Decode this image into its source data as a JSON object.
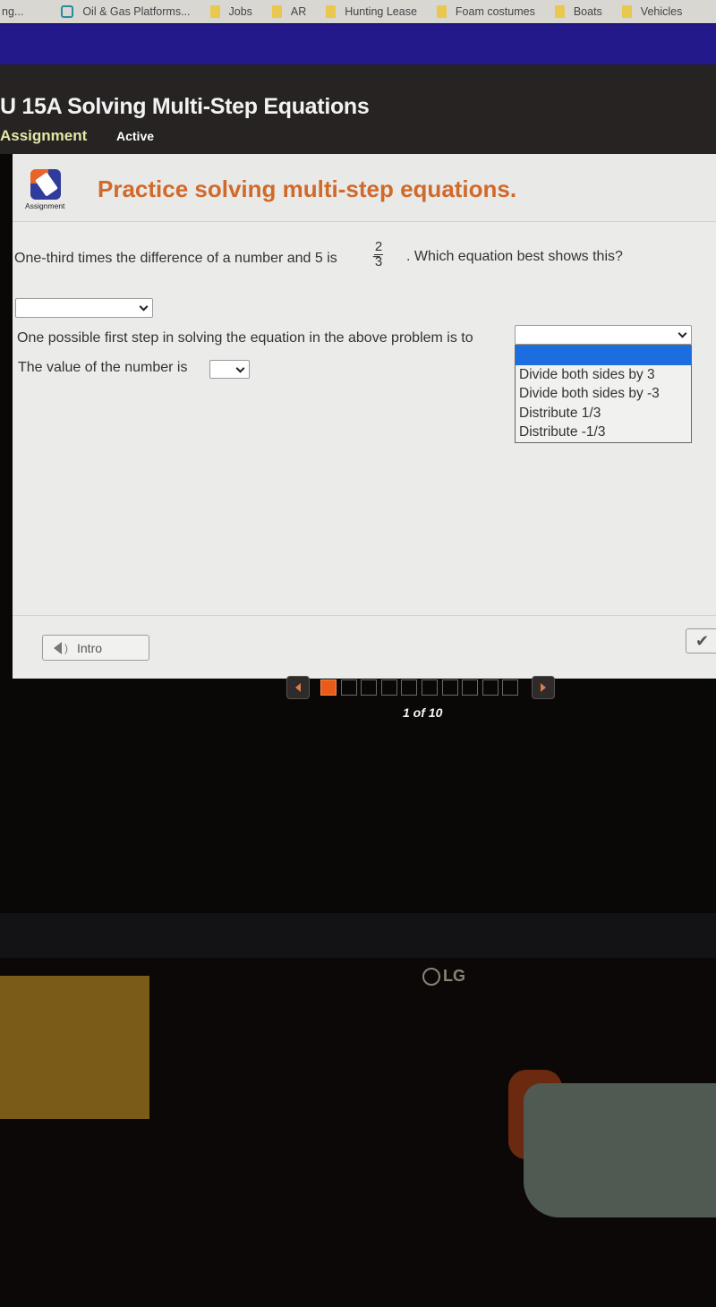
{
  "bookmarks": [
    {
      "label": "ng...",
      "icon": "none"
    },
    {
      "label": "Oil & Gas Platforms...",
      "icon": "site-icon"
    },
    {
      "label": "Jobs",
      "icon": "folder-icon"
    },
    {
      "label": "AR",
      "icon": "folder-icon"
    },
    {
      "label": "Hunting Lease",
      "icon": "folder-icon"
    },
    {
      "label": "Foam costumes",
      "icon": "folder-icon"
    },
    {
      "label": "Boats",
      "icon": "folder-icon"
    },
    {
      "label": "Vehicles",
      "icon": "folder-icon"
    }
  ],
  "header": {
    "title": "U 15A Solving Multi-Step Equations",
    "assignment_type": "Assignment",
    "status": "Active"
  },
  "panel": {
    "icon_label": "Assignment",
    "prompt": "Practice solving multi-step equations.",
    "question_part1": "One-third times the difference of a number and 5 is",
    "fraction": {
      "sign": "−",
      "numerator": "2",
      "denominator": "3"
    },
    "question_part2": ". Which equation best shows this?",
    "equation_select_value": "",
    "first_step_text": "One possible first step in solving the equation in the above problem is to",
    "first_step_select_value": "",
    "first_step_options": [
      "",
      "Divide both sides by 3",
      "Divide both sides by -3",
      "Distribute 1/3",
      "Distribute -1/3"
    ],
    "value_text": "The value of the number is",
    "value_select_value": "",
    "intro_button": "Intro",
    "check_button": "✔"
  },
  "pager": {
    "current": 1,
    "total": 10,
    "label": "1 of 10"
  },
  "monitor_brand": "LG",
  "colors": {
    "accent_orange": "#d06a2b",
    "header_bg": "#262322",
    "blue_band": "#23198a",
    "selected_option": "#1c6ee0",
    "pager_current": "#ea5b19"
  }
}
